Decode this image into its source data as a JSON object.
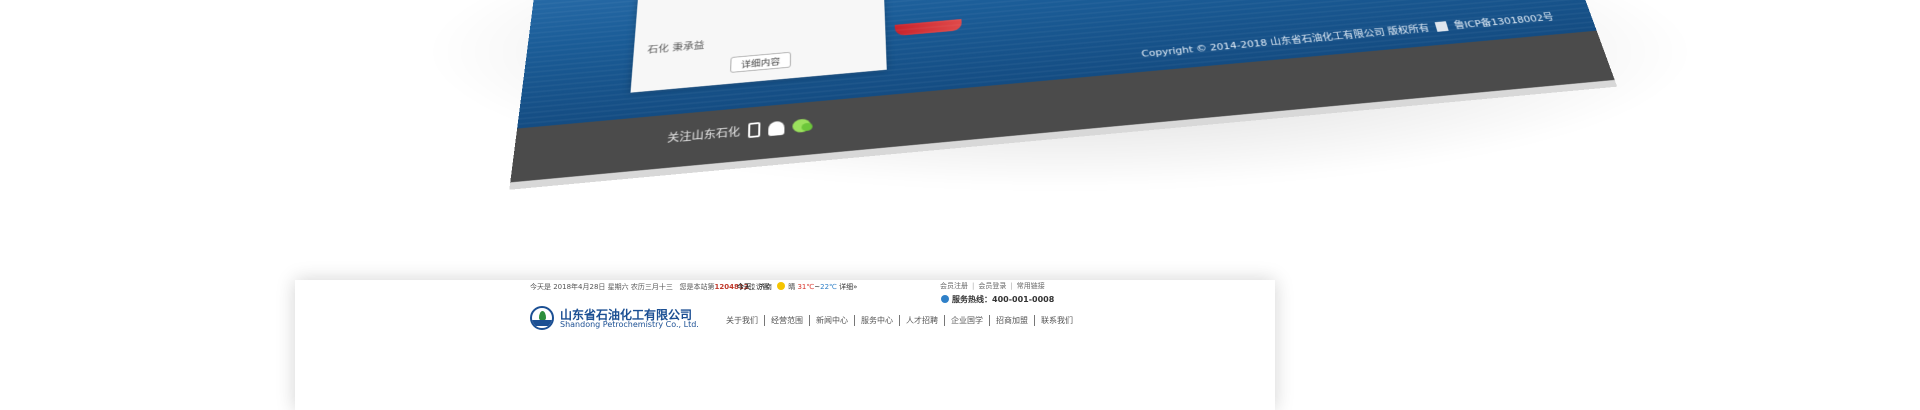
{
  "mockup": {
    "card_text": "石化  秉承益",
    "detail_button": "详细内容",
    "copyright": "Copyright © 2014-2018  山东省石油化工有限公司 版权所有",
    "icp": "鲁ICP备13018002号",
    "follow_label": "关注山东石化",
    "colors": {
      "sea": "#1b5d98",
      "bar": "#4b4b4b"
    }
  },
  "site": {
    "date_text": "今天是 2018年4月28日 星期六 农历三月十三",
    "visitor_prefix": "您是本站第",
    "visitor_count": "1204812",
    "visitor_suffix": "位访客",
    "weather": {
      "today_label": "今天：",
      "city": "济南",
      "condition": "晴",
      "high": "31℃",
      "tilde": "~",
      "low": "22℃",
      "detail_link": "详细»"
    },
    "top_links": [
      "会员注册",
      "会员登录",
      "常用链接"
    ],
    "hotline": "服务热线：400-001-0008",
    "logo": {
      "cn": "山东省石油化工有限公司",
      "en": "Shandong Petrochemistry Co., Ltd."
    },
    "nav": [
      "关于我们",
      "经营范围",
      "新闻中心",
      "服务中心",
      "人才招聘",
      "企业国学",
      "招商加盟",
      "联系我们"
    ],
    "colors": {
      "brand": "#1b4f93",
      "count": "#c0392b"
    }
  }
}
